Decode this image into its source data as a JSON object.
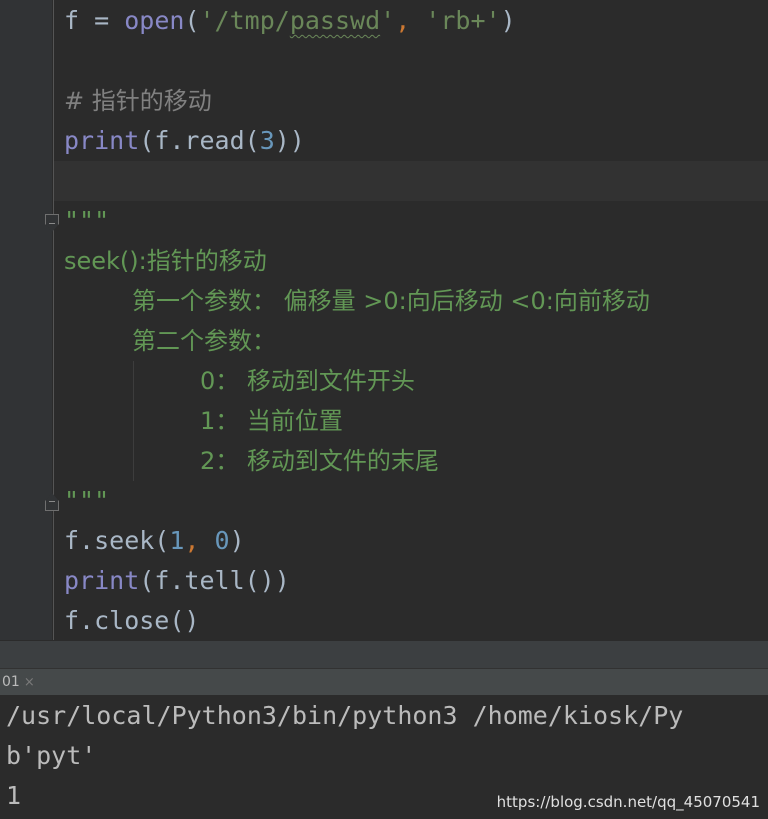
{
  "editor": {
    "line1": {
      "var": "f = ",
      "func": "open",
      "p1": "(",
      "str1": "'/tmp/",
      "str_sq": "passwd",
      "str1b": "'",
      "comma": ", ",
      "str2": "'rb+'",
      "p2": ")"
    },
    "comment": "# 指针的移动",
    "line3": {
      "func": "print",
      "rest1": "(f.read(",
      "num": "3",
      "rest2": "))"
    },
    "doc_open": "\"\"\"",
    "doc_seek": "seek():指针的移动",
    "doc_param1": "第一个参数： 偏移量 >0:向后移动 <0:向前移动",
    "doc_param2": "第二个参数：",
    "doc_opt0": "0： 移动到文件开头",
    "doc_opt1": "1： 当前位置",
    "doc_opt2": "2： 移动到文件的末尾",
    "doc_close": "\"\"\"",
    "seek_line": {
      "a": "f.seek(",
      "n1": "1",
      "comma": ", ",
      "n2": "0",
      "b": ")"
    },
    "tell_line": {
      "func": "print",
      "rest": "(f.tell())"
    },
    "close_line": "f.close()"
  },
  "run_panel": {
    "tab_label": "01",
    "tab_close": "×",
    "output": [
      "/usr/local/Python3/bin/python3 /home/kiosk/Py",
      "b'pyt'",
      "1"
    ]
  },
  "watermark": "https://blog.csdn.net/qq_45070541",
  "colors": {
    "background": "#2b2b2b",
    "builtin": "#8888c6",
    "string": "#6a8759",
    "number": "#6897bb",
    "docstring": "#629755",
    "comment": "#808080"
  }
}
